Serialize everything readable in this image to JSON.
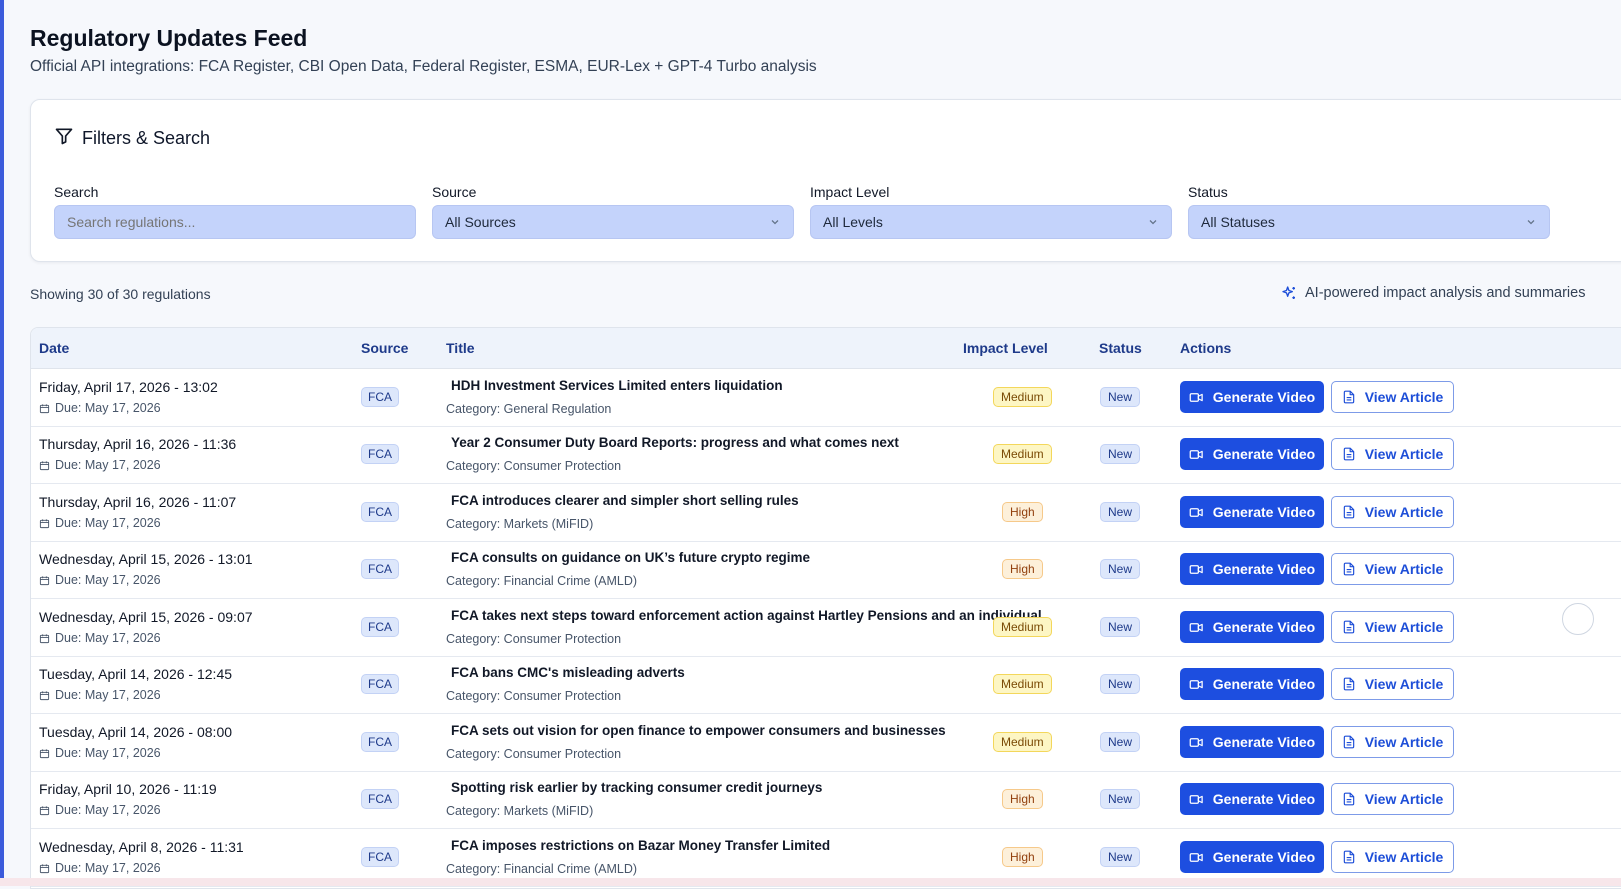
{
  "header": {
    "title": "Regulatory Updates Feed",
    "subtitle": "Official API integrations: FCA Register, CBI Open Data, Federal Register, ESMA, EUR-Lex + GPT-4 Turbo analysis"
  },
  "filters": {
    "title": "Filters & Search",
    "search": {
      "label": "Search",
      "placeholder": "Search regulations...",
      "value": ""
    },
    "source": {
      "label": "Source",
      "selected": "All Sources"
    },
    "impact": {
      "label": "Impact Level",
      "selected": "All Levels"
    },
    "status": {
      "label": "Status",
      "selected": "All Statuses"
    }
  },
  "summary": {
    "count_text": "Showing 30 of 30 regulations",
    "ai_note": "AI-powered impact analysis and summaries"
  },
  "table": {
    "columns": [
      "Date",
      "Source",
      "Title",
      "Impact Level",
      "Status",
      "Actions"
    ],
    "generate_label": "Generate Video",
    "view_label": "View Article",
    "rows": [
      {
        "date": "Friday, April 17, 2026 - 13:02",
        "due": "Due: May 17, 2026",
        "source": "FCA",
        "title": "HDH Investment Services Limited enters liquidation",
        "category": "Category: General Regulation",
        "impact": "Medium",
        "status": "New"
      },
      {
        "date": "Thursday, April 16, 2026 - 11:36",
        "due": "Due: May 17, 2026",
        "source": "FCA",
        "title": "Year 2 Consumer Duty Board Reports: progress and what comes next",
        "category": "Category: Consumer Protection",
        "impact": "Medium",
        "status": "New"
      },
      {
        "date": "Thursday, April 16, 2026 - 11:07",
        "due": "Due: May 17, 2026",
        "source": "FCA",
        "title": "FCA introduces clearer and simpler short selling rules",
        "category": "Category: Markets (MiFID)",
        "impact": "High",
        "status": "New"
      },
      {
        "date": "Wednesday, April 15, 2026 - 13:01",
        "due": "Due: May 17, 2026",
        "source": "FCA",
        "title": "FCA consults on guidance on UK’s future crypto regime",
        "category": "Category: Financial Crime (AMLD)",
        "impact": "High",
        "status": "New"
      },
      {
        "date": "Wednesday, April 15, 2026 - 09:07",
        "due": "Due: May 17, 2026",
        "source": "FCA",
        "title": "FCA takes next steps toward enforcement action against Hartley Pensions and an individual",
        "category": "Category: Consumer Protection",
        "impact": "Medium",
        "status": "New"
      },
      {
        "date": "Tuesday, April 14, 2026 - 12:45",
        "due": "Due: May 17, 2026",
        "source": "FCA",
        "title": "FCA bans CMC's misleading adverts",
        "category": "Category: Consumer Protection",
        "impact": "Medium",
        "status": "New"
      },
      {
        "date": "Tuesday, April 14, 2026 - 08:00",
        "due": "Due: May 17, 2026",
        "source": "FCA",
        "title": "FCA sets out vision for open finance to empower consumers and businesses",
        "category": "Category: Consumer Protection",
        "impact": "Medium",
        "status": "New"
      },
      {
        "date": "Friday, April 10, 2026 - 11:19",
        "due": "Due: May 17, 2026",
        "source": "FCA",
        "title": "Spotting risk earlier by tracking consumer credit journeys",
        "category": "Category: Markets (MiFID)",
        "impact": "High",
        "status": "New"
      },
      {
        "date": "Wednesday, April 8, 2026 - 11:31",
        "due": "Due: May 17, 2026",
        "source": "FCA",
        "title": "FCA imposes restrictions on Bazar Money Transfer Limited",
        "category": "Category: Financial Crime (AMLD)",
        "impact": "High",
        "status": "New"
      }
    ]
  }
}
